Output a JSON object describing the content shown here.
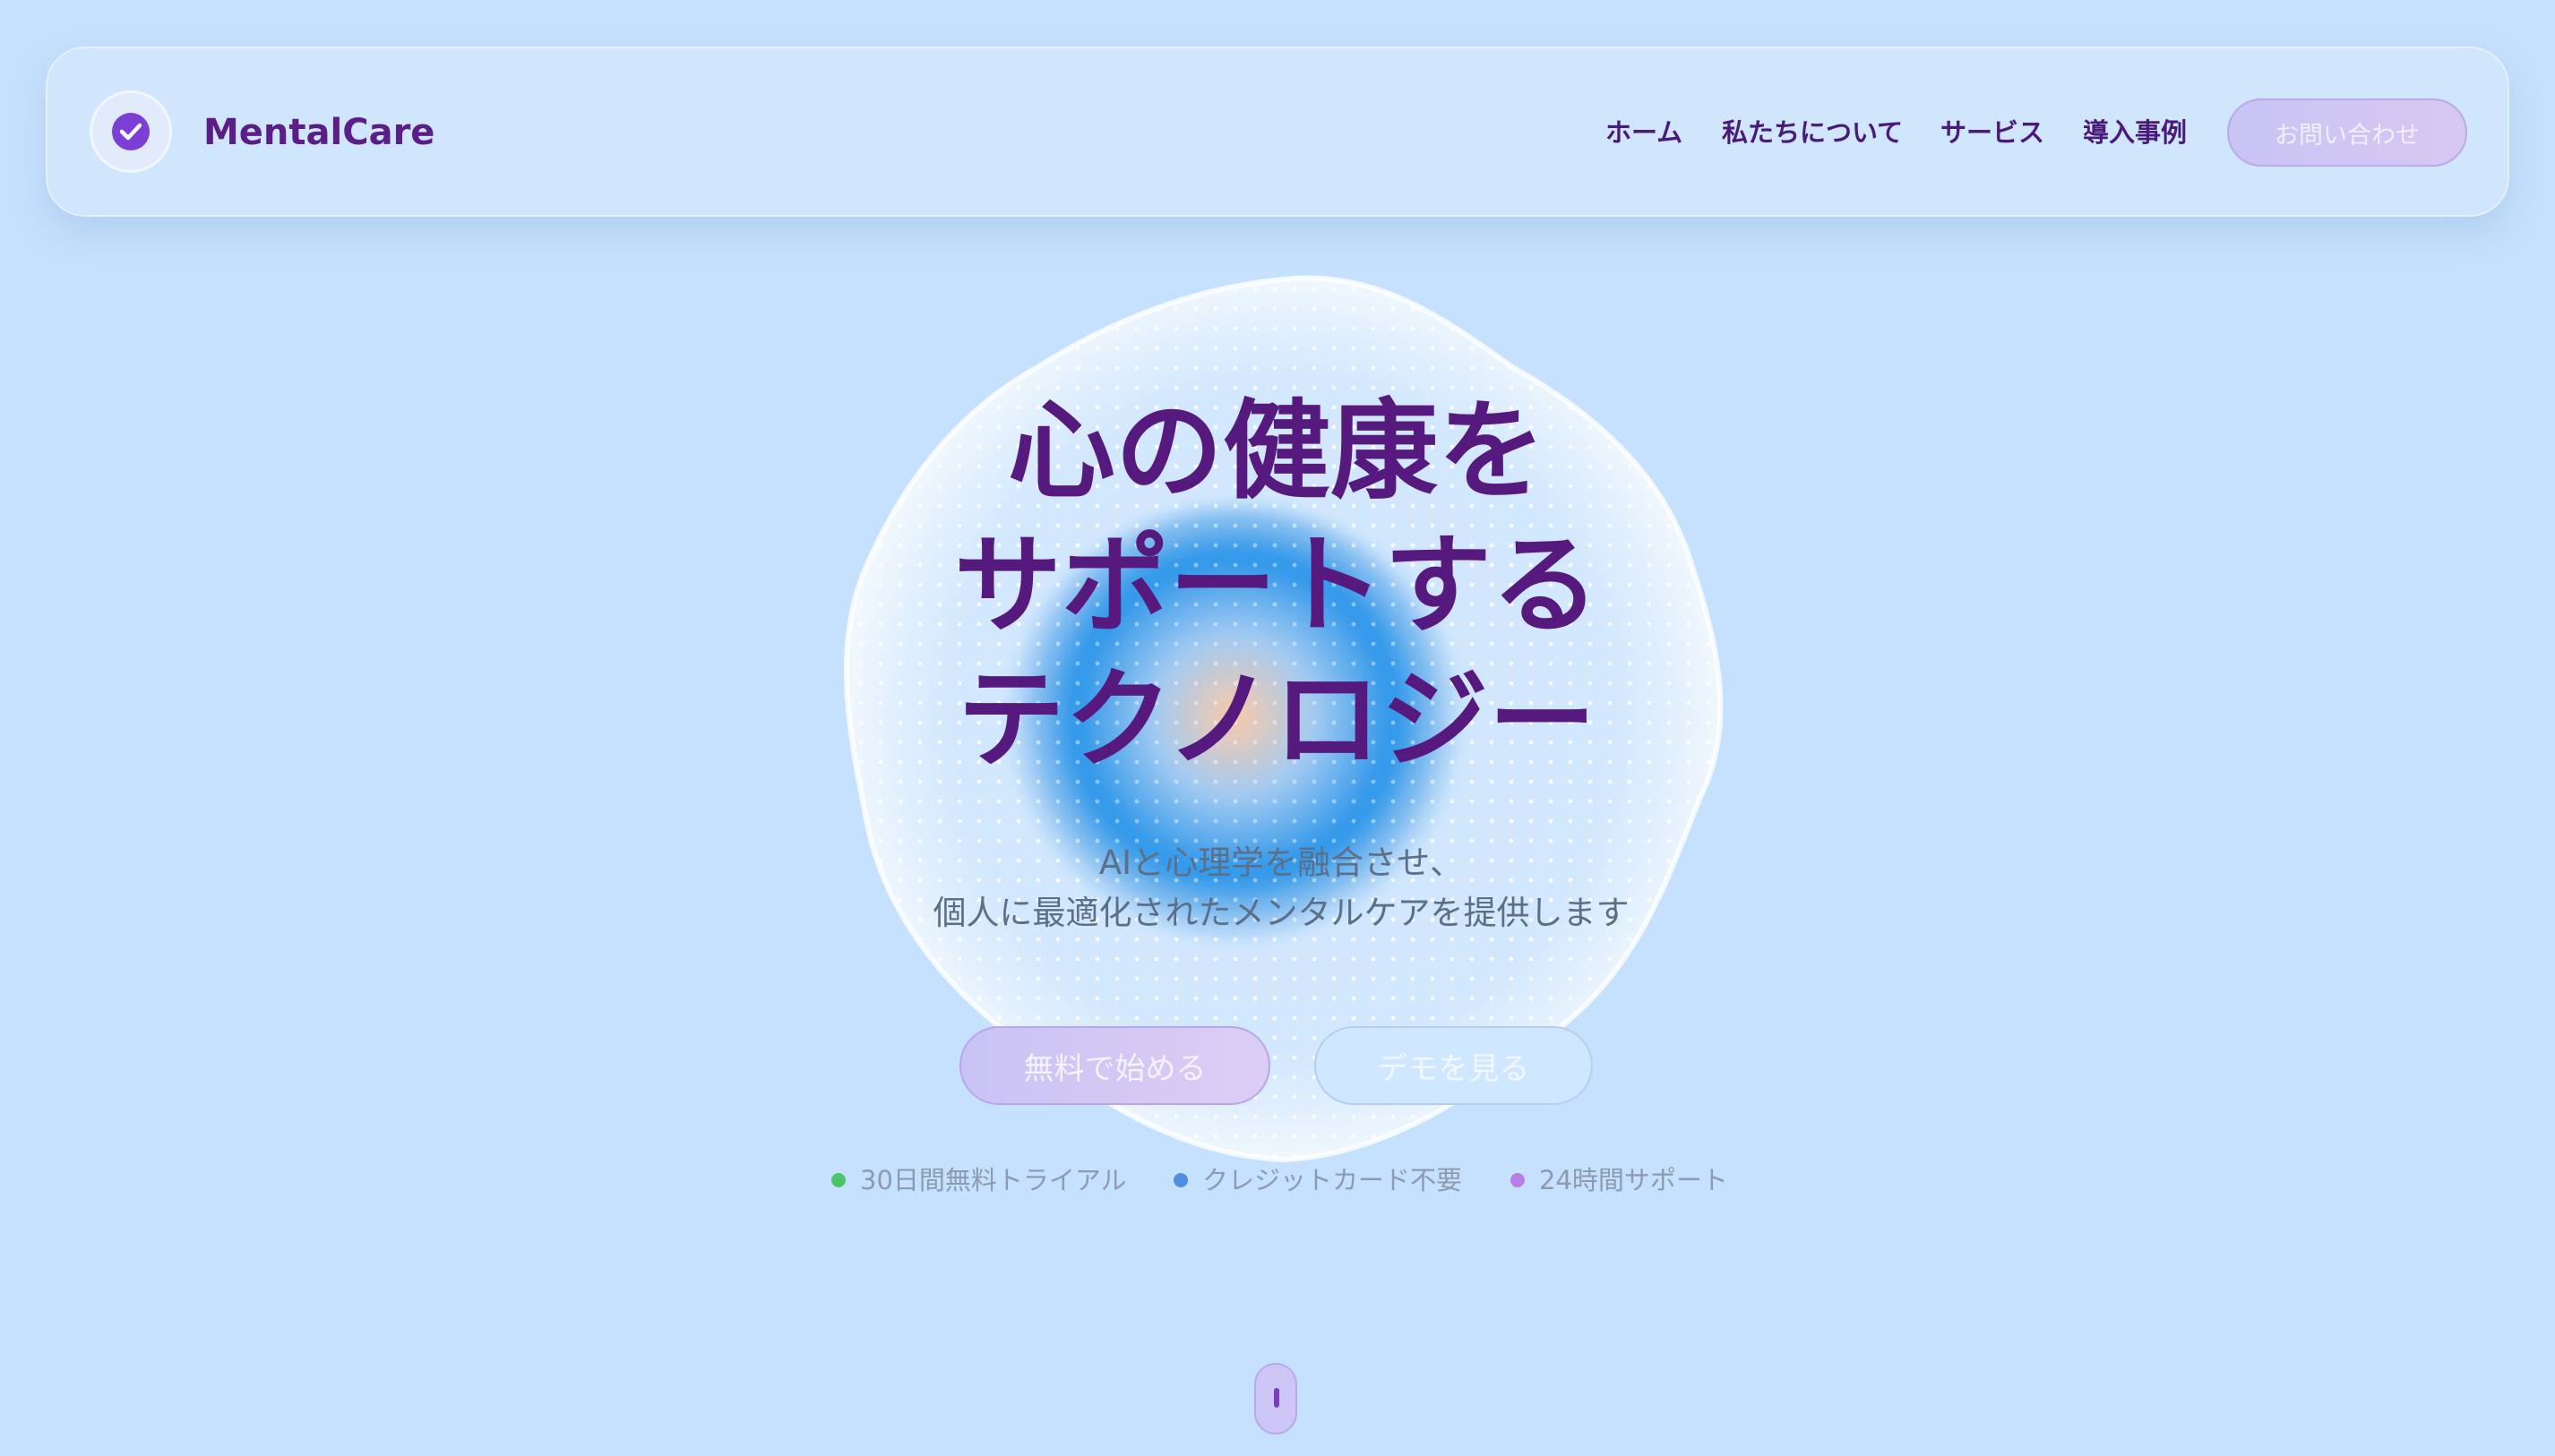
{
  "brand": {
    "name": "MentalCare",
    "logo_icon": "check-circle-icon"
  },
  "nav": {
    "links": [
      "ホーム",
      "私たちについて",
      "サービス",
      "導入事例"
    ],
    "contact_label": "お問い合わせ"
  },
  "hero": {
    "title_lines": [
      "心の健康を",
      "サポートする",
      "テクノロジー"
    ],
    "subtitle_lines": [
      "AIと心理学を融合させ、",
      "個人に最適化されたメンタルケアを提供します"
    ],
    "primary_cta": "無料で始める",
    "secondary_cta": "デモを見る"
  },
  "features": [
    {
      "label": "30日間無料トライアル",
      "color": "#4cc56a"
    },
    {
      "label": "クレジットカード不要",
      "color": "#4f8fe0"
    },
    {
      "label": "24時間サポート",
      "color": "#b77ee6"
    }
  ],
  "colors": {
    "background": "#c6e1fd",
    "brand_purple": "#561a7f",
    "accent_violet": "#7a3fb8"
  },
  "scroll_indicator_icon": "mouse-scroll-icon"
}
